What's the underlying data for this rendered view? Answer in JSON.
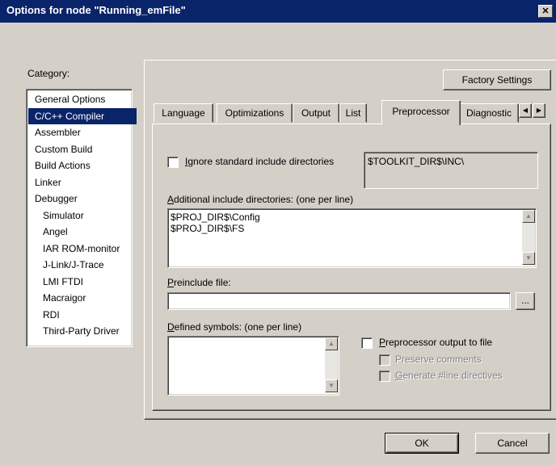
{
  "window": {
    "title": "Options for node \"Running_emFile\"",
    "close_glyph": "✕"
  },
  "category": {
    "label": "Category:",
    "items": [
      {
        "label": "General Options",
        "indent": false,
        "selected": false
      },
      {
        "label": "C/C++ Compiler",
        "indent": false,
        "selected": true
      },
      {
        "label": "Assembler",
        "indent": false,
        "selected": false
      },
      {
        "label": "Custom Build",
        "indent": false,
        "selected": false
      },
      {
        "label": "Build Actions",
        "indent": false,
        "selected": false
      },
      {
        "label": "Linker",
        "indent": false,
        "selected": false
      },
      {
        "label": "Debugger",
        "indent": false,
        "selected": false
      },
      {
        "label": "Simulator",
        "indent": true,
        "selected": false
      },
      {
        "label": "Angel",
        "indent": true,
        "selected": false
      },
      {
        "label": "IAR ROM-monitor",
        "indent": true,
        "selected": false
      },
      {
        "label": "J-Link/J-Trace",
        "indent": true,
        "selected": false
      },
      {
        "label": "LMI FTDI",
        "indent": true,
        "selected": false
      },
      {
        "label": "Macraigor",
        "indent": true,
        "selected": false
      },
      {
        "label": "RDI",
        "indent": true,
        "selected": false
      },
      {
        "label": "Third-Party Driver",
        "indent": true,
        "selected": false
      }
    ]
  },
  "factory_settings_label": "Factory Settings",
  "tabs": [
    {
      "label": "Language"
    },
    {
      "label": "Optimizations"
    },
    {
      "label": "Output"
    },
    {
      "label": "List"
    },
    {
      "label": "Preprocessor"
    },
    {
      "label": "Diagnostic"
    }
  ],
  "tab_scroll": {
    "left": "◀",
    "right": "▶"
  },
  "preprocessor": {
    "ignore_std_label_u": "I",
    "ignore_std_label_rest": "gnore standard include directories",
    "toolkit_dir": "$TOOLKIT_DIR$\\INC\\",
    "additional_label_u": "A",
    "additional_label_rest": "dditional include directories: (one per line)",
    "additional_lines": [
      "$PROJ_DIR$\\Config",
      "$PROJ_DIR$\\FS"
    ],
    "preinclude_label_u": "P",
    "preinclude_label_rest": "reinclude file:",
    "preinclude_value": "",
    "browse_label": "...",
    "defined_label_u": "D",
    "defined_label_rest": "efined symbols: (one per line)",
    "pp_output_label_u": "P",
    "pp_output_label_rest": "reprocessor output to file",
    "preserve_comments_label": "Preserve comments",
    "generate_line_label_u": "G",
    "generate_line_label_rest": "enerate #line directives"
  },
  "ok_label": "OK",
  "cancel_label": "Cancel"
}
